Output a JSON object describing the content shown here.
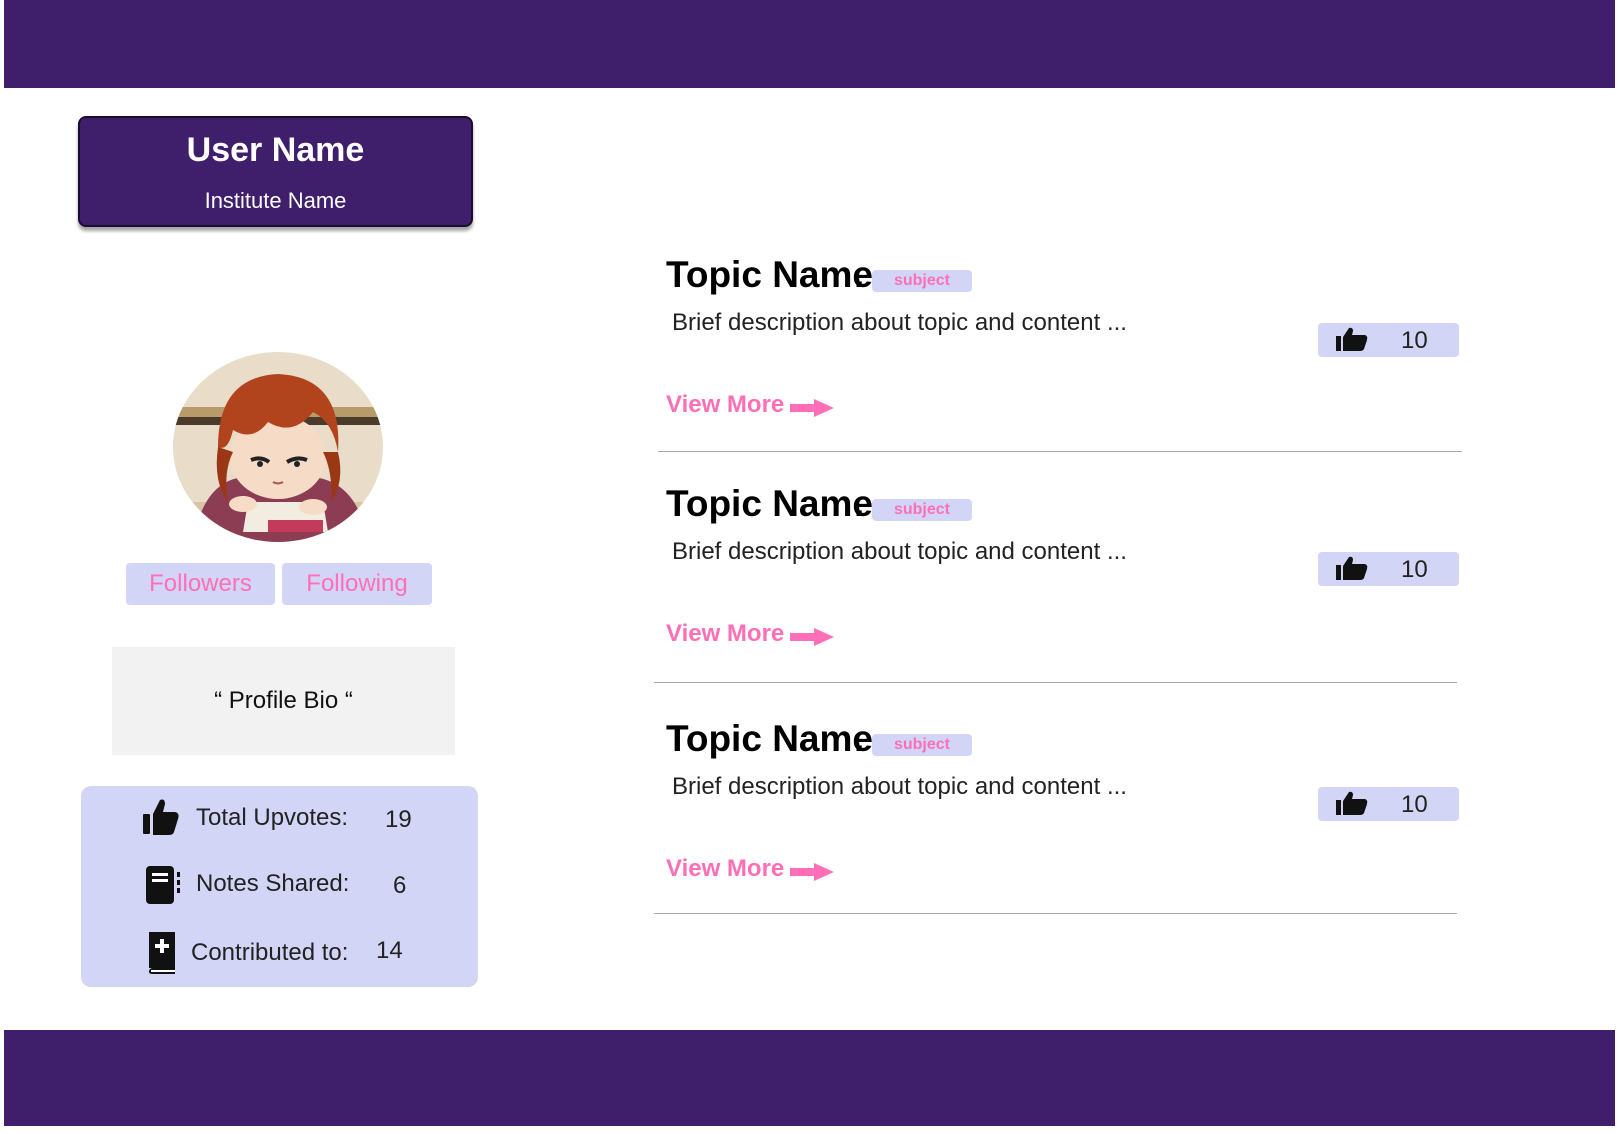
{
  "profile": {
    "user_name": "User Name",
    "institute_name": "Institute Name",
    "followers_label": "Followers",
    "following_label": "Following",
    "bio": "“ Profile Bio “"
  },
  "stats": {
    "total_upvotes_label": "Total Upvotes:",
    "total_upvotes_value": "19",
    "notes_shared_label": "Notes Shared:",
    "notes_shared_value": "6",
    "contributed_label": "Contributed to:",
    "contributed_value": "14"
  },
  "topics": [
    {
      "title": "Topic Name",
      "dot": ".",
      "subject": "subject",
      "description": "Brief description about topic and content ...",
      "upvotes": "10",
      "view_more": "View More"
    },
    {
      "title": "Topic Name",
      "dot": ".",
      "subject": "subject",
      "description": "Brief description about topic and content ...",
      "upvotes": "10",
      "view_more": "View More"
    },
    {
      "title": "Topic Name",
      "dot": ".",
      "subject": "subject",
      "description": "Brief description about topic and content ...",
      "upvotes": "10",
      "view_more": "View More"
    }
  ],
  "colors": {
    "brand_purple": "#3f1f6b",
    "accent_pink": "#ff6fb8",
    "pill_lavender": "#d2d5f5"
  }
}
